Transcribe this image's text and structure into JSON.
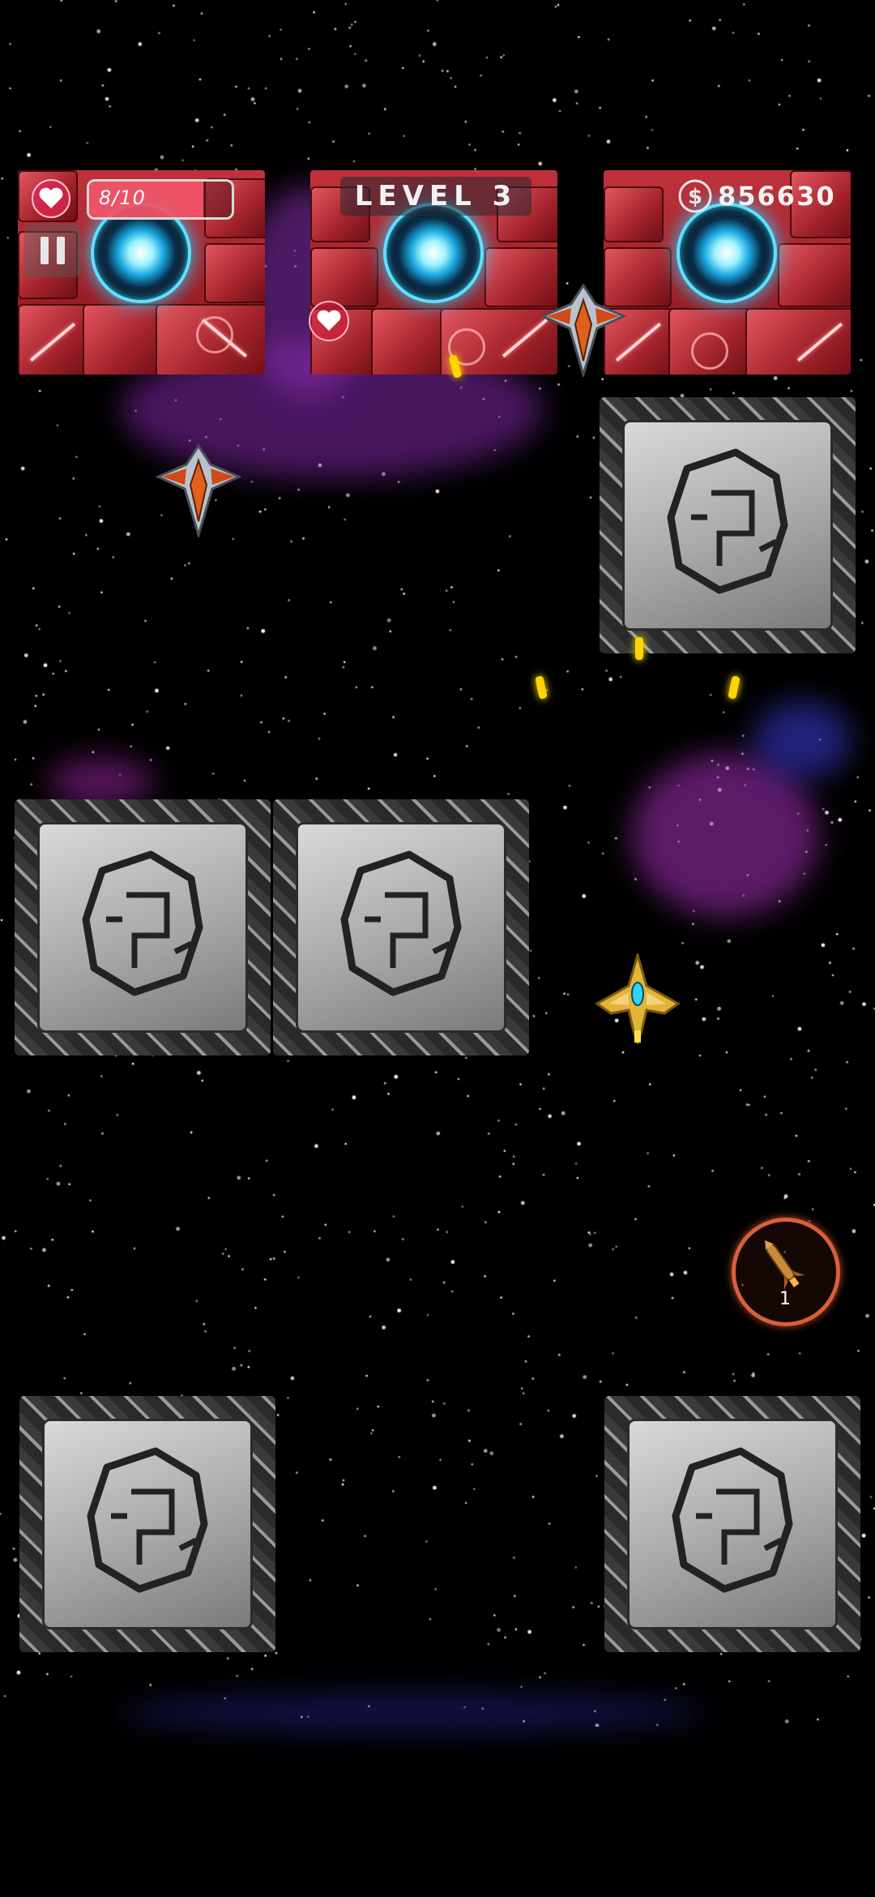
{
  "hud": {
    "health_text": "8/10",
    "health_fraction": 0.8,
    "level_label": "LEVEL 3",
    "coins": "856630",
    "pause_icon": "pause-icon",
    "heart_icon": "heart-icon",
    "coin_icon": "dollar-coin-icon"
  },
  "powerups": {
    "missile_icon": "missile-icon",
    "missile_count": "1"
  },
  "colors": {
    "bunker_red": "#b72a33",
    "core_blue": "#28d1ff",
    "bullet_yellow": "#ffd400",
    "health_pink": "#ff5a6e",
    "missile_ring": "#d8603a"
  }
}
